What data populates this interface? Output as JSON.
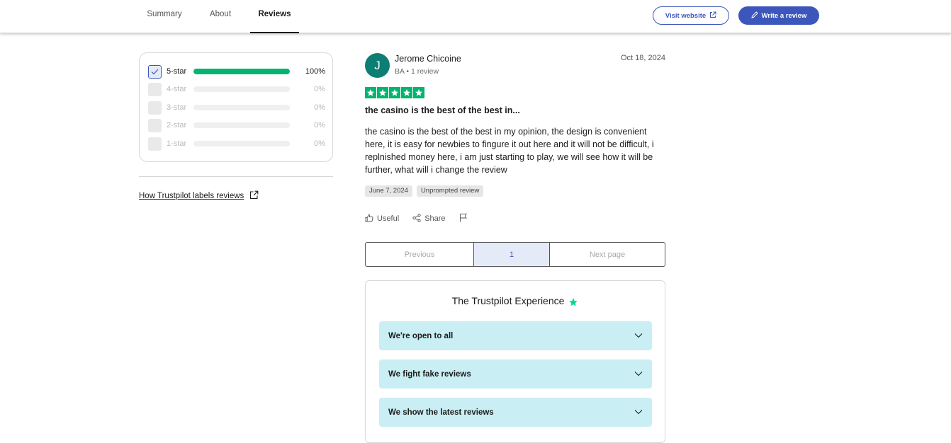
{
  "nav": {
    "tabs": [
      {
        "label": "Summary"
      },
      {
        "label": "About"
      },
      {
        "label": "Reviews"
      }
    ],
    "visit_label": "Visit website",
    "write_label": "Write a review",
    "accent": "#3c57bc"
  },
  "filters": {
    "rows": [
      {
        "label": "5-star",
        "percent_text": "100%",
        "percent": 100,
        "checked": true
      },
      {
        "label": "4-star",
        "percent_text": "0%",
        "percent": 0,
        "checked": false
      },
      {
        "label": "3-star",
        "percent_text": "0%",
        "percent": 0,
        "checked": false
      },
      {
        "label": "2-star",
        "percent_text": "0%",
        "percent": 0,
        "checked": false
      },
      {
        "label": "1-star",
        "percent_text": "0%",
        "percent": 0,
        "checked": false
      }
    ],
    "bar_color": "#04b46f"
  },
  "labels_link": "How Trustpilot labels reviews",
  "review": {
    "avatar_initial": "J",
    "avatar_color": "#0c7e73",
    "author": "Jerome Chicoine",
    "meta": "BA • 1 review",
    "date": "Oct 18, 2024",
    "stars": 5,
    "title": "the casino is the best of the best in...",
    "body": "the casino is the best of the best in my opinion, the design is convenient here, it is easy for newbies to fingure it out here and it will not be difficult, i replnished money here, i am just starting to play, we will see how it will be further, what will i change the review",
    "tags": [
      "June 7, 2024",
      "Unprompted review"
    ],
    "useful_label": "Useful",
    "share_label": "Share"
  },
  "pagination": {
    "prev_label": "Previous",
    "current_page": "1",
    "next_label": "Next page"
  },
  "experience": {
    "title": "The Trustpilot Experience",
    "items": [
      {
        "label": "We're open to all"
      },
      {
        "label": "We fight fake reviews"
      },
      {
        "label": "We show the latest reviews"
      }
    ]
  }
}
